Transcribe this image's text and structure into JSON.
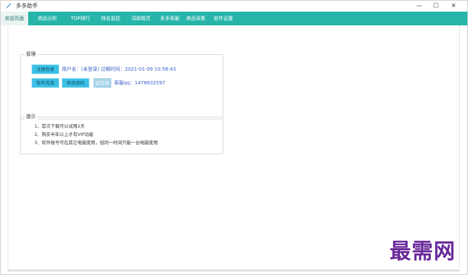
{
  "window": {
    "title": "多多助手",
    "controls": {
      "minimize": "—",
      "maximize": "☐",
      "close": "✕"
    }
  },
  "tabs": [
    {
      "label": "欢迎页面",
      "active": true
    },
    {
      "label": "商品分析",
      "active": false
    },
    {
      "label": "TOP排行",
      "active": false
    },
    {
      "label": "排名监控",
      "active": false
    },
    {
      "label": "词库精灵",
      "active": false
    },
    {
      "label": "多多客服",
      "active": false
    },
    {
      "label": "商品采集",
      "active": false
    },
    {
      "label": "软件设置",
      "active": false
    }
  ],
  "management": {
    "label": "管理",
    "register_login": "注册登录",
    "user_info": "用户名：(未登录) 过期时间：2021-01-09 10:58:43",
    "recharge": "软件充值",
    "change_password": "修改密码",
    "verify": "验交讲",
    "service_qq": "客服qq：1478632597"
  },
  "tips": {
    "label": "提示",
    "lines": [
      "1、首次下载可以试用2天",
      "2、购买半年以上才有VIP功能",
      "3、软件账号可在其它电脑使用，但同一时间只能一台电脑使用"
    ]
  },
  "watermark": "最需网",
  "colors": {
    "tab_bar": "#27b5aa",
    "button": "#3bc0e6",
    "link_text": "#3a5fc8",
    "watermark": "#6a2a9a"
  }
}
